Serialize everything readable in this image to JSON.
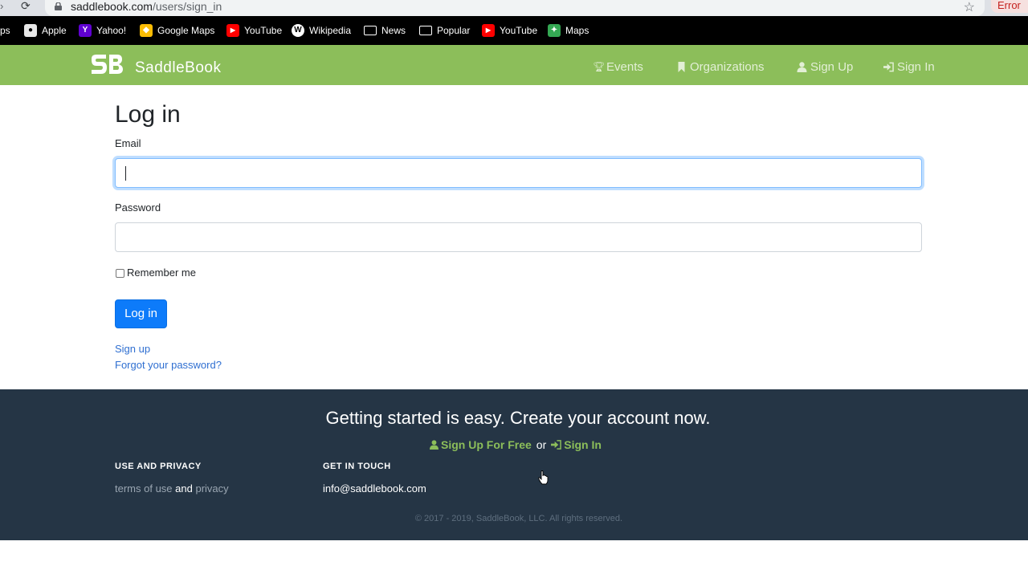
{
  "browser": {
    "url_host": "saddlebook.com",
    "url_path": "/users/sign_in",
    "error_label": "Error",
    "partial_left_label": "ps"
  },
  "bookmarks": [
    {
      "label": "Apple",
      "icon": "apple-icon"
    },
    {
      "label": "Yahoo!",
      "icon": "yahoo-icon"
    },
    {
      "label": "Google Maps",
      "icon": "google-maps-icon"
    },
    {
      "label": "YouTube",
      "icon": "youtube-icon"
    },
    {
      "label": "Wikipedia",
      "icon": "wikipedia-icon"
    },
    {
      "label": "News",
      "icon": "folder-icon"
    },
    {
      "label": "Popular",
      "icon": "folder-icon"
    },
    {
      "label": "YouTube",
      "icon": "youtube-icon"
    },
    {
      "label": "Maps",
      "icon": "maps-icon"
    }
  ],
  "navbar": {
    "brand": "SaddleBook",
    "items": [
      {
        "label": "Events",
        "icon": "trophy-icon"
      },
      {
        "label": "Organizations",
        "icon": "bookmark-icon"
      },
      {
        "label": "Sign Up",
        "icon": "user-icon"
      },
      {
        "label": "Sign In",
        "icon": "sign-in-icon"
      }
    ]
  },
  "form": {
    "title": "Log in",
    "email_label": "Email",
    "email_value": "",
    "password_label": "Password",
    "password_value": "",
    "remember_label": "Remember me",
    "remember_checked": false,
    "submit_label": "Log in",
    "signup_link": "Sign up",
    "forgot_link": "Forgot your password?"
  },
  "footer": {
    "cta": "Getting started is easy. Create your account now.",
    "signup_free": "Sign Up For Free",
    "or": "or",
    "sign_in": "Sign In",
    "use_privacy_heading": "USE AND PRIVACY",
    "terms_link": "terms of use",
    "and": "and",
    "privacy_link": "privacy",
    "contact_heading": "GET IN TOUCH",
    "email": "info@saddlebook.com",
    "copyright": "© 2017 - 2019, SaddleBook, LLC. All rights reserved."
  },
  "colors": {
    "navbar_bg": "#8cbe5a",
    "footer_bg": "#253545",
    "primary_button": "#0d7bfa",
    "link": "#2f6fd1",
    "accent_green": "#8cbe5a"
  }
}
